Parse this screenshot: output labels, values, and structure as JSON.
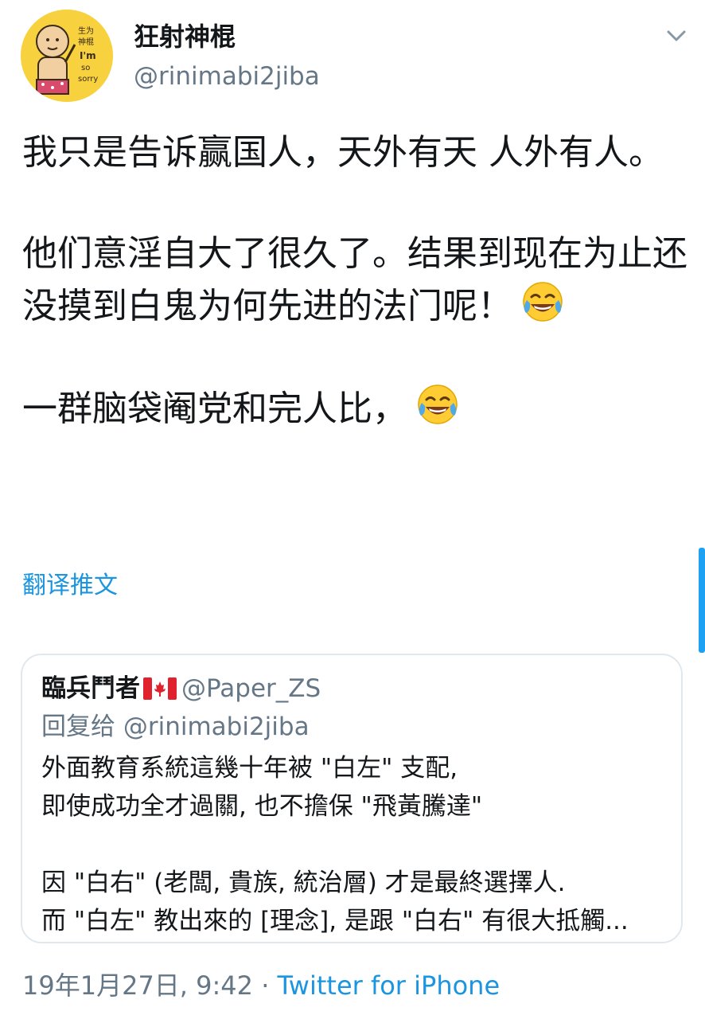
{
  "author": {
    "display_name": "狂射神棍",
    "handle": "@rinimabi2jiba",
    "avatar_text": [
      "生为",
      "神棍",
      "I'm",
      "so",
      "sorry"
    ]
  },
  "tweet": {
    "paragraphs": [
      {
        "text": "我只是告诉赢国人，天外有天 人外有人。",
        "emoji": ""
      },
      {
        "text": "他们意淫自大了很久了。结果到现在为止还没摸到白鬼为何先进的法门呢！",
        "emoji": "face-with-tears-of-joy"
      },
      {
        "text": "一群脑袋阉党和完人比，",
        "emoji": "face-with-tears-of-joy"
      }
    ],
    "translate_label": "翻译推文"
  },
  "quoted_tweet": {
    "display_name": "臨兵鬥者",
    "flag_icon": "canada-flag",
    "handle": "@Paper_ZS",
    "reply_to": "回复给 @rinimabi2jiba",
    "paragraphs": [
      [
        "外面教育系統這幾十年被 \"白左\" 支配,",
        "即使成功全才過關, 也不擔保 \"飛黃騰達\""
      ],
      [
        "因 \"白右\" (老闆, 貴族, 統治層) 才是最終選擇人.",
        "而 \"白左\" 教出來的 [理念], 是跟 \"白右\" 有很大抵觸..."
      ]
    ]
  },
  "meta": {
    "timestamp": "19年1月27日, 9:42",
    "separator": " · ",
    "source": "Twitter for iPhone"
  },
  "colors": {
    "link": "#1b95e0",
    "secondary_text": "#657786",
    "primary_text": "#14171a",
    "border": "#e1e8ed",
    "scroll_indicator": "#1da1f2",
    "avatar_bg": "#f7d23e"
  }
}
